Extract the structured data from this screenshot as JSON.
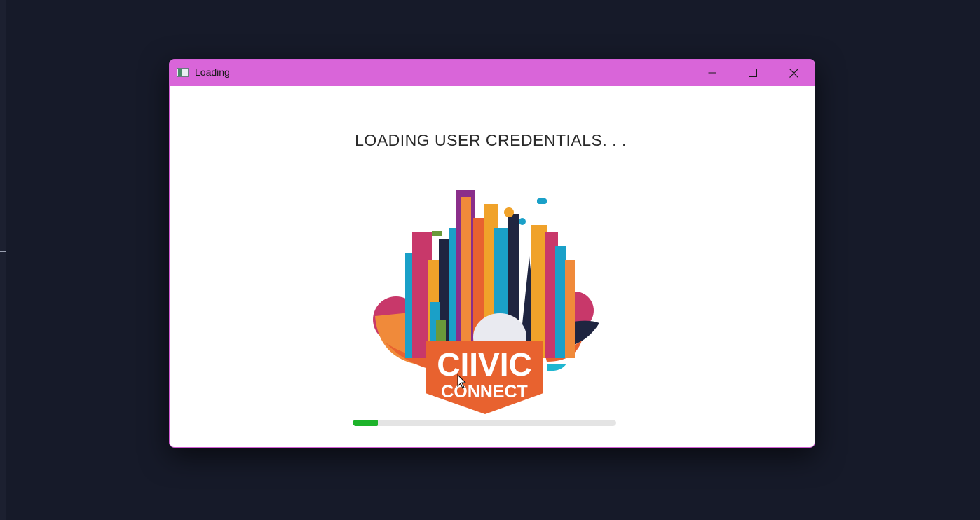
{
  "window": {
    "title": "Loading",
    "titlebar_color": "#d965d9",
    "icons": [
      "app-icon",
      "minimize-icon",
      "maximize-icon",
      "close-icon"
    ]
  },
  "loading": {
    "message": "LOADING USER CREDENTIALS. . .",
    "progress_percent": 9.5,
    "progress_color": "#1db32a"
  },
  "logo": {
    "line1": "CIIVIC",
    "line2": "CONNECT",
    "banner_color": "#e8622f"
  }
}
